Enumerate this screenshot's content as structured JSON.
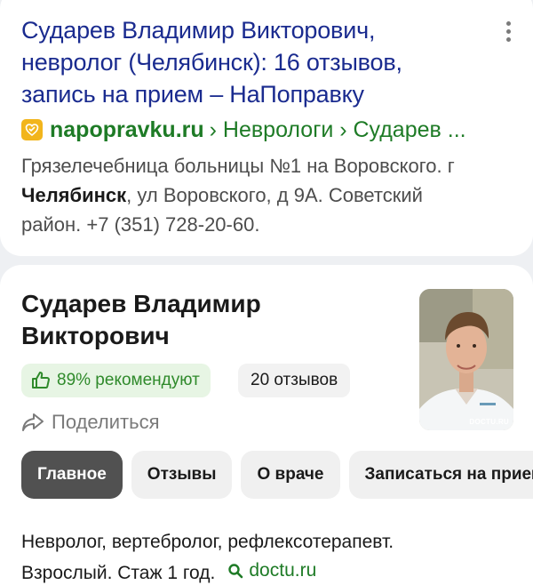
{
  "result": {
    "title_lines": [
      "Сударев Владимир Викторович,",
      "невролог (Челябинск): 16 отзывов,",
      "запись на прием – НаПоправку"
    ],
    "domain": "napopravku.ru",
    "breadcrumb": "› Неврологи › Сударев ...",
    "snippet_part1": "Грязелечебница больницы №1 на Воровского. г ",
    "snippet_bold": "Челябинск",
    "snippet_part2": ", ул Воровского, д 9А. Советский район. +7 (351) 728-20-60."
  },
  "doctor": {
    "name_lines": [
      "Сударев Владимир",
      "Викторович"
    ],
    "recommend_text": "89% рекомендуют",
    "reviews_text": "20 отзывов",
    "share_label": "Поделиться",
    "photo_watermark": "DOCTU.RU",
    "tabs": [
      {
        "label": "Главное",
        "active": true
      },
      {
        "label": "Отзывы",
        "active": false
      },
      {
        "label": "О враче",
        "active": false
      },
      {
        "label": "Записаться на прием",
        "active": false
      }
    ],
    "desc_line1": "Невролог, вертебролог, рефлексотерапевт.",
    "desc_line2": "Взрослый. Стаж 1 год.",
    "source_label": "doctu.ru"
  },
  "colors": {
    "title_link": "#1a2b8f",
    "url_green": "#1e7b26",
    "recommend_green": "#2f8a2b",
    "active_tab": "#515151",
    "favicon": "#f2b51c"
  },
  "icons": [
    "more-vertical-icon",
    "napopravku-favicon",
    "thumbs-up-icon",
    "share-icon",
    "search-icon"
  ]
}
